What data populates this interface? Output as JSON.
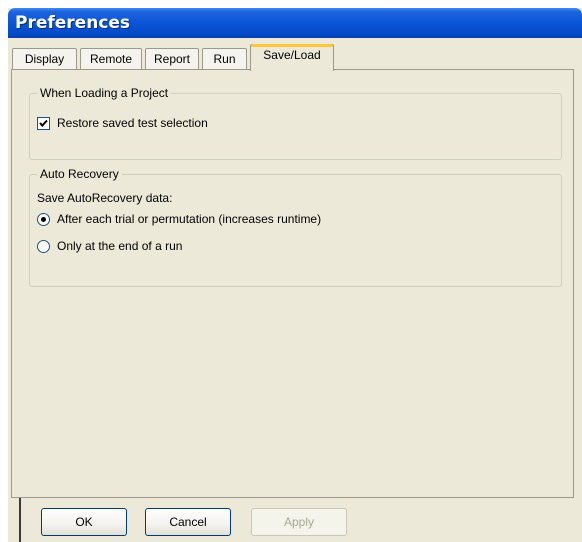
{
  "window": {
    "title": "Preferences"
  },
  "tabs": [
    {
      "label": "Display",
      "active": false
    },
    {
      "label": "Remote",
      "active": false
    },
    {
      "label": "Report",
      "active": false
    },
    {
      "label": "Run",
      "active": false
    },
    {
      "label": "Save/Load",
      "active": true
    }
  ],
  "loading_group": {
    "title": "When Loading a Project",
    "restore_label": "Restore saved test selection",
    "restore_checked": true
  },
  "recovery_group": {
    "title": "Auto Recovery",
    "prompt": "Save AutoRecovery data:",
    "options": [
      {
        "label": "After each trial or permutation (increases runtime)",
        "selected": true
      },
      {
        "label": "Only at the end of a run",
        "selected": false
      }
    ]
  },
  "buttons": {
    "ok": "OK",
    "cancel": "Cancel",
    "apply": "Apply",
    "apply_enabled": false
  },
  "colors": {
    "titlebar": "#0a55d6",
    "dialog_bg": "#ece9d8",
    "active_tab_highlight": "#ffc83c"
  }
}
